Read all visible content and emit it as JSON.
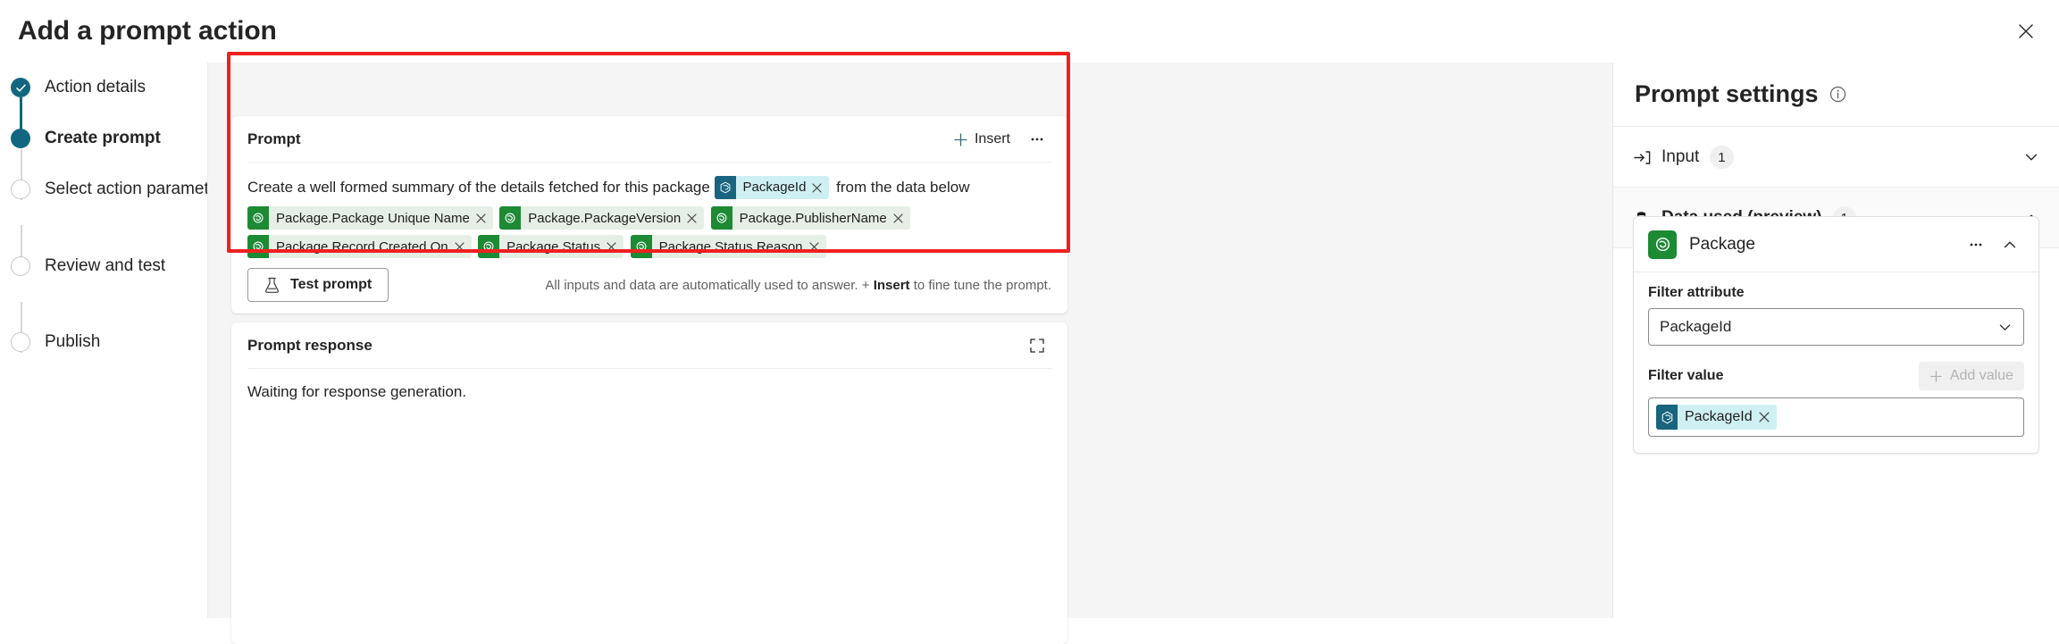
{
  "dialog": {
    "title": "Add a prompt action",
    "close_icon": "close-icon"
  },
  "wizard": {
    "steps": [
      {
        "label": "Action details",
        "state": "done"
      },
      {
        "label": "Create prompt",
        "state": "active"
      },
      {
        "label": "Select action parameters",
        "state": "todo"
      },
      {
        "label": "Review and test",
        "state": "todo"
      },
      {
        "label": "Publish",
        "state": "todo"
      }
    ]
  },
  "prompt_card": {
    "title": "Prompt",
    "insert_label": "Insert",
    "more_label": "•••",
    "text_before": "Create a well formed summary of the details fetched for this package",
    "inline_chip": {
      "label": "PackageId",
      "type": "blue"
    },
    "text_after": "from the data below",
    "data_chips": [
      {
        "label": "Package.Package Unique Name",
        "type": "green"
      },
      {
        "label": "Package.PackageVersion",
        "type": "green"
      },
      {
        "label": "Package.PublisherName",
        "type": "green"
      },
      {
        "label": "Package.Record Created On",
        "type": "green"
      },
      {
        "label": "Package.Status",
        "type": "green"
      },
      {
        "label": "Package.Status Reason",
        "type": "green"
      }
    ],
    "test_button_label": "Test prompt",
    "hint_prefix": "All inputs and data are automatically used to answer. +",
    "hint_bold": "Insert",
    "hint_suffix": "to fine tune the prompt."
  },
  "response_card": {
    "title": "Prompt response",
    "expand_icon": "expand-icon",
    "body_text": "Waiting for response generation."
  },
  "settings": {
    "title": "Prompt settings",
    "info_icon": "info-icon",
    "sections": [
      {
        "label": "Input",
        "count": "1",
        "icon": "input-arrow-icon",
        "expanded": false,
        "bold": false
      },
      {
        "label": "Data used (preview)",
        "count": "1",
        "icon": "database-icon",
        "expanded": true,
        "bold": true
      }
    ],
    "data_card": {
      "table_name": "Package",
      "table_icon": "dataverse-table-icon",
      "filter_attribute_label": "Filter attribute",
      "filter_attribute_value": "PackageId",
      "filter_value_label": "Filter value",
      "add_value_label": "Add value",
      "filter_value_chip": {
        "label": "PackageId",
        "type": "blue"
      }
    }
  },
  "colors": {
    "accent_teal": "#11677f",
    "chip_blue_bg": "#cff0f3",
    "chip_blue_badge": "#19647e",
    "chip_green_bg": "#e6efe6",
    "chip_green_badge": "#1d8a34",
    "highlight_red": "#f02020",
    "content_bg": "#f5f5f5"
  }
}
